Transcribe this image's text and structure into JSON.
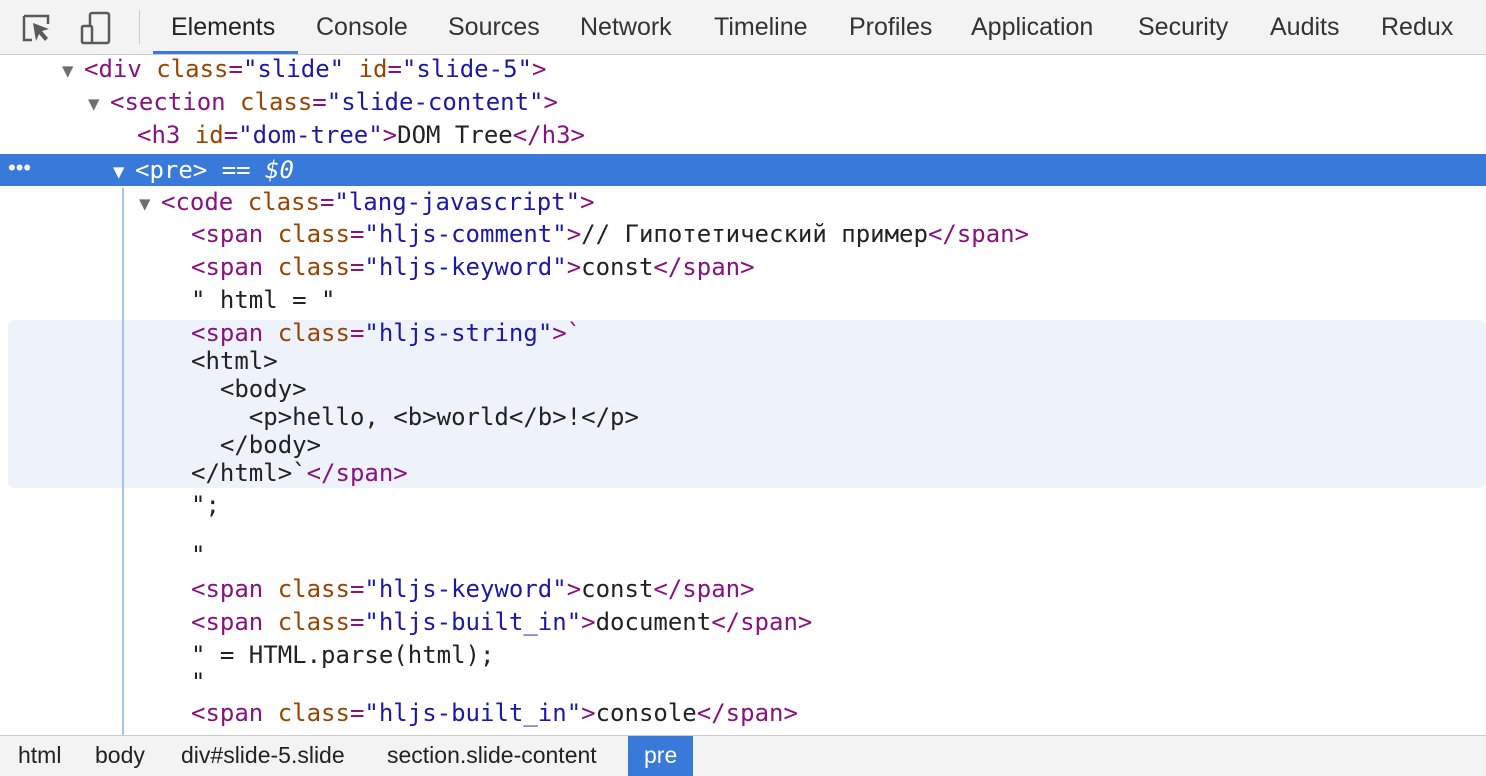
{
  "toolbar": {
    "inspect_icon": "inspect-element-icon",
    "device_icon": "device-toolbar-icon",
    "tabs": [
      {
        "label": "Elements"
      },
      {
        "label": "Console"
      },
      {
        "label": "Sources"
      },
      {
        "label": "Network"
      },
      {
        "label": "Timeline"
      },
      {
        "label": "Profiles"
      },
      {
        "label": "Application"
      },
      {
        "label": "Security"
      },
      {
        "label": "Audits"
      },
      {
        "label": "Redux"
      }
    ],
    "active_tab": "Elements"
  },
  "tree": {
    "div": {
      "open": "<div",
      "attr1": "class",
      "val1": "slide",
      "attr2": "id",
      "val2": "slide-5",
      "close": ">"
    },
    "section": {
      "open": "<section",
      "attr1": "class",
      "val1": "slide-content",
      "close": ">"
    },
    "h3": {
      "open": "<h3",
      "attr1": "id",
      "val1": "dom-tree",
      "close": ">",
      "text": "DOM Tree",
      "end": "</h3>"
    },
    "pre": {
      "dots": "•••",
      "tag": "<pre>",
      "eq": " == ",
      "var": "$0"
    },
    "code": {
      "open": "<code",
      "attr1": "class",
      "val1": "lang-javascript",
      "close": ">"
    },
    "span_comment": {
      "open": "<span",
      "attr1": "class",
      "val1": "hljs-comment",
      "close": ">",
      "text": "// Гипотетический пример",
      "end": "</span>"
    },
    "span_keyword1": {
      "open": "<span",
      "attr1": "class",
      "val1": "hljs-keyword",
      "close": ">",
      "text": "const",
      "end": "</span>"
    },
    "text_html": "\" html = \"",
    "span_string": {
      "open": "<span",
      "attr1": "class",
      "val1": "hljs-string",
      "close": ">`",
      "lines": [
        "<html>",
        "  <body>",
        "    <p>hello, <b>world</b>!</p>",
        "  </body>"
      ],
      "last_text": "</html>`",
      "end": "</span>"
    },
    "text_semicolon": "\";",
    "text_quote": "\"",
    "span_keyword2": {
      "open": "<span",
      "attr1": "class",
      "val1": "hljs-keyword",
      "close": ">",
      "text": "const",
      "end": "</span>"
    },
    "span_builtin1": {
      "open": "<span",
      "attr1": "class",
      "val1": "hljs-built_in",
      "close": ">",
      "text": "document",
      "end": "</span>"
    },
    "text_parse": "\" = HTML.parse(html);",
    "text_quote2": "\"",
    "span_builtin2": {
      "open": "<span",
      "attr1": "class",
      "val1": "hljs-built_in",
      "close": ">",
      "text": "console",
      "end": "</span>"
    }
  },
  "breadcrumbs": [
    {
      "label": "html"
    },
    {
      "label": "body"
    },
    {
      "label": "div#slide-5.slide"
    },
    {
      "label": "section.slide-content"
    },
    {
      "label": "pre"
    }
  ],
  "colors": {
    "accent": "#3879d9",
    "tag": "#881280",
    "attribute": "#994500",
    "value": "#1a1aa6"
  }
}
